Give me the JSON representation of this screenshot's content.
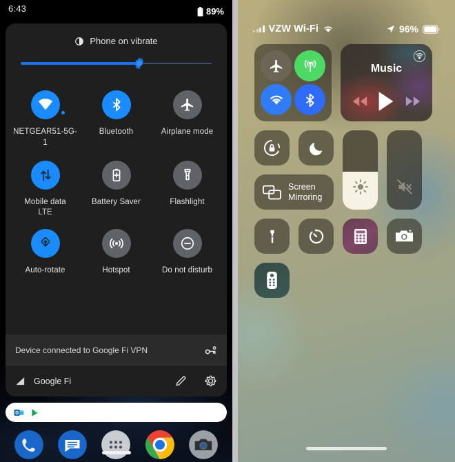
{
  "android": {
    "status_bar": {
      "time": "6:43",
      "battery_percent": "89%",
      "battery_icon": "battery-icon"
    },
    "brightness": {
      "label": "Phone on vibrate",
      "icon": "vibrate-icon",
      "value_percent": 62
    },
    "tiles": [
      {
        "label": "NETGEAR51-5G-1",
        "sublabel": "",
        "icon": "wifi-icon",
        "state": "on",
        "badge": true
      },
      {
        "label": "Bluetooth",
        "sublabel": "",
        "icon": "bluetooth-icon",
        "state": "on",
        "badge": false
      },
      {
        "label": "Airplane mode",
        "sublabel": "",
        "icon": "airplane-icon",
        "state": "off",
        "badge": false
      },
      {
        "label": "Mobile data",
        "sublabel": "LTE",
        "icon": "mobile-data-icon",
        "state": "on",
        "badge": false
      },
      {
        "label": "Battery Saver",
        "sublabel": "",
        "icon": "battery-saver-icon",
        "state": "off",
        "badge": false
      },
      {
        "label": "Flashlight",
        "sublabel": "",
        "icon": "flashlight-icon",
        "state": "off",
        "badge": false
      },
      {
        "label": "Auto-rotate",
        "sublabel": "",
        "icon": "auto-rotate-icon",
        "state": "on",
        "badge": false
      },
      {
        "label": "Hotspot",
        "sublabel": "",
        "icon": "hotspot-icon",
        "state": "off",
        "badge": false
      },
      {
        "label": "Do not disturb",
        "sublabel": "",
        "icon": "do-not-disturb-icon",
        "state": "off",
        "badge": false
      }
    ],
    "vpn_row": {
      "text": "Device connected to Google Fi VPN",
      "icon": "vpn-key-icon"
    },
    "carrier_row": {
      "name": "Google Fi",
      "signal_icon": "signal-bars-icon",
      "edit_icon": "pencil-icon",
      "settings_icon": "gear-icon"
    },
    "notification_shelf": {
      "icons": [
        "outlook-icon",
        "play-store-games-icon"
      ]
    },
    "dock": [
      {
        "icon": "phone-icon"
      },
      {
        "icon": "messages-icon"
      },
      {
        "icon": "app-drawer-icon"
      },
      {
        "icon": "chrome-icon"
      },
      {
        "icon": "camera-icon"
      }
    ],
    "nav_bar": {
      "icon": "home-pill-icon"
    },
    "colors": {
      "accent": "#1a8cff",
      "panel": "#1f1f1f",
      "vpn_row": "#2b2b2b"
    }
  },
  "ios": {
    "status_bar": {
      "carrier": "VZW Wi-Fi",
      "signal_icon": "cellular-bars-icon",
      "wifi_icon": "wifi-icon",
      "location_icon": "location-arrow-icon",
      "battery_percent": "96%",
      "battery_icon": "battery-icon"
    },
    "connectivity": {
      "airplane": {
        "icon": "airplane-icon",
        "state": "off"
      },
      "cellular": {
        "icon": "cellular-data-icon",
        "state": "on"
      },
      "wifi": {
        "icon": "wifi-icon",
        "state": "on"
      },
      "bluetooth": {
        "icon": "bluetooth-icon",
        "state": "on"
      }
    },
    "music": {
      "title": "Music",
      "airplay_icon": "airplay-audio-icon",
      "prev_icon": "rewind-icon",
      "play_icon": "play-icon",
      "next_icon": "fast-forward-icon"
    },
    "rotation_lock": {
      "icon": "rotation-lock-icon",
      "state": "off"
    },
    "do_not_disturb": {
      "icon": "moon-icon",
      "state": "off"
    },
    "screen_mirroring": {
      "label_line1": "Screen",
      "label_line2": "Mirroring",
      "icon": "screen-mirroring-icon"
    },
    "brightness": {
      "icon": "brightness-sun-icon",
      "value_percent": 48
    },
    "volume": {
      "icon": "volume-mute-icon",
      "value_percent": 0
    },
    "shortcuts": [
      {
        "icon": "flashlight-icon",
        "name": "flashlight"
      },
      {
        "icon": "timer-icon",
        "name": "timer"
      },
      {
        "icon": "calculator-icon",
        "name": "calculator"
      },
      {
        "icon": "camera-icon",
        "name": "camera"
      },
      {
        "icon": "apple-tv-remote-icon",
        "name": "apple-tv-remote"
      }
    ],
    "home_indicator": {
      "icon": "home-indicator-icon"
    },
    "colors": {
      "green": "#4cd964",
      "blue": "#2f7cf6",
      "bt_blue": "#2f6bf6",
      "slider_fill": "#f6f3e4"
    }
  }
}
